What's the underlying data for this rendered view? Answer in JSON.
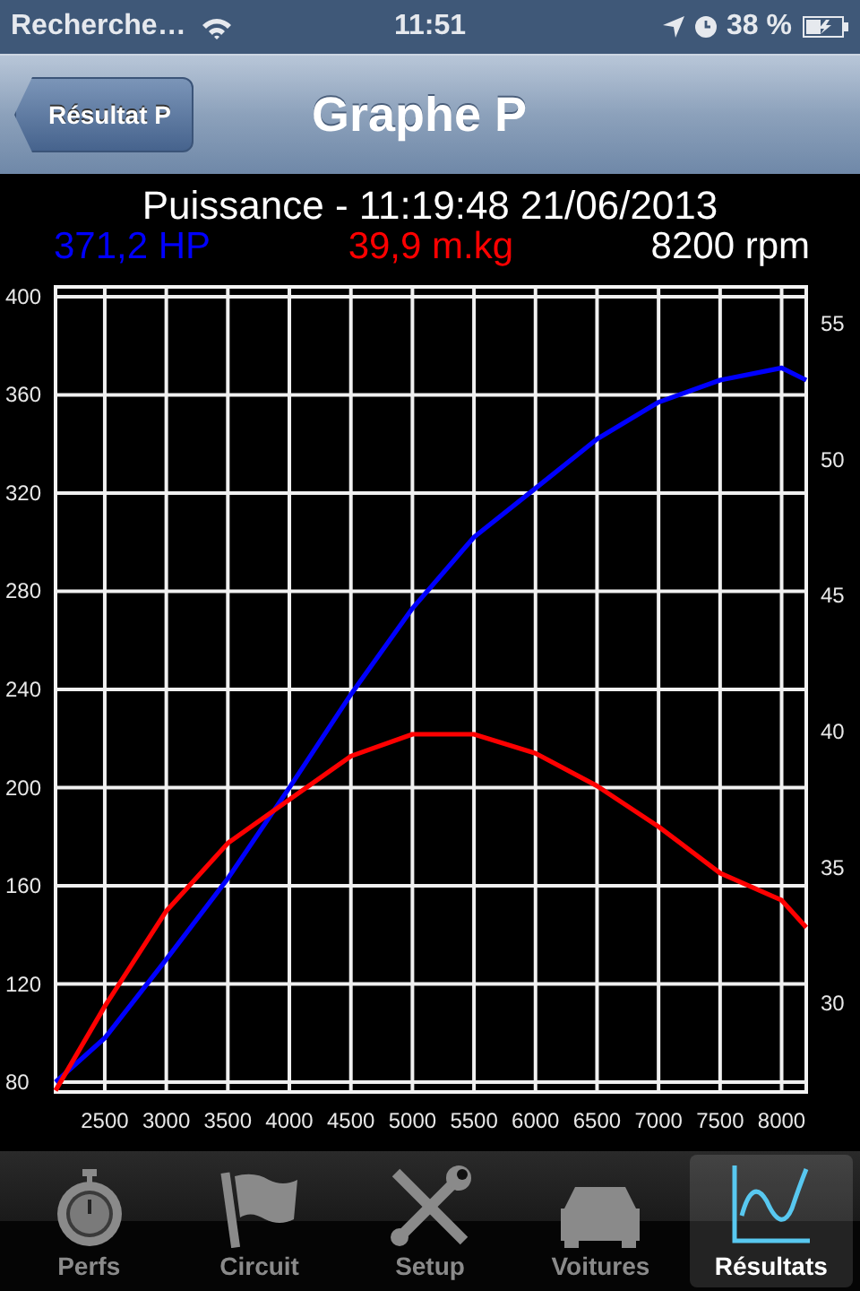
{
  "status_bar": {
    "carrier": "Recherche…",
    "time": "11:51",
    "battery": "38 %"
  },
  "nav_bar": {
    "back_button": "Résultat P",
    "title": "Graphe P"
  },
  "header": {
    "title": "Puissance - 11:19:48 21/06/2013",
    "readings": [
      {
        "text": "371,2 HP",
        "color": "#0000ff"
      },
      {
        "text": "39,9 m.kg",
        "color": "#ff0000"
      },
      {
        "text": "8200 rpm",
        "color": "#ffffff"
      }
    ]
  },
  "chart": {
    "chart_data": {
      "type": "line",
      "x": [
        2100,
        2500,
        3000,
        3500,
        4000,
        4500,
        5000,
        5500,
        6000,
        6500,
        7000,
        7500,
        8000,
        8200
      ],
      "series": [
        {
          "color": "#0000ff",
          "values": [
            80,
            98,
            130,
            163,
            200,
            238,
            273,
            302,
            322,
            342,
            357,
            366,
            371,
            366
          ]
        },
        {
          "color": "#ff0000",
          "axis": "y2",
          "values": [
            26.8,
            29.9,
            33.4,
            35.9,
            37.5,
            39.1,
            39.9,
            39.9,
            39.2,
            38.0,
            36.5,
            34.8,
            33.8,
            32.8
          ]
        }
      ],
      "xlim": [
        2100,
        8200
      ],
      "ylim": [
        76,
        404
      ],
      "xticks": [
        2500,
        3000,
        3500,
        4000,
        4500,
        5000,
        5500,
        6000,
        6500,
        7000,
        7500,
        8000
      ],
      "yticks": [
        80,
        120,
        160,
        200,
        240,
        280,
        320,
        360,
        400
      ],
      "grid": true,
      "y2lim": [
        26.75,
        56.35
      ],
      "y2ticks": [
        30,
        35,
        40,
        45,
        50,
        55
      ]
    }
  },
  "tab_bar": [
    {
      "label": "Perfs",
      "kind": "stopwatch",
      "selected": false
    },
    {
      "label": "Circuit",
      "kind": "flag",
      "selected": false
    },
    {
      "label": "Setup",
      "kind": "tools",
      "selected": false
    },
    {
      "label": "Voitures",
      "kind": "car",
      "selected": false
    },
    {
      "label": "Résultats",
      "kind": "graph",
      "selected": true
    }
  ]
}
